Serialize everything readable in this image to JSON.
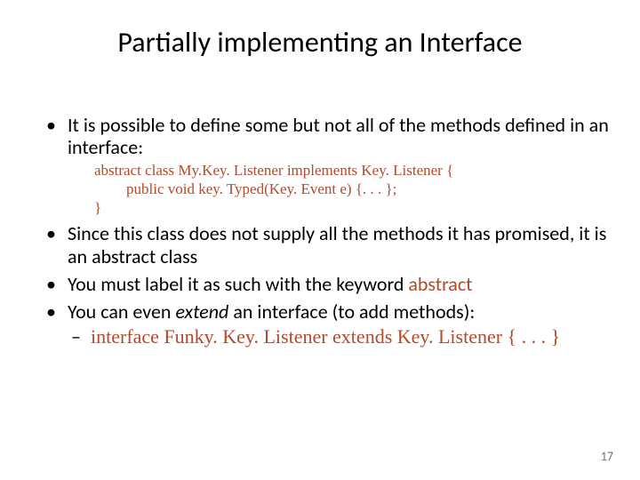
{
  "title": "Partially implementing an Interface",
  "bullets": {
    "b1": "It is possible to define some but not all of the methods defined in an interface:",
    "b2": "Since this class does not supply all the methods it has promised, it is an abstract class",
    "b3_pre": "You must label it as such with the keyword ",
    "b3_kw": "abstract",
    "b4_pre": "You can even ",
    "b4_em": "extend",
    "b4_post": " an interface (to add methods):"
  },
  "code": {
    "l1": "abstract class My.Key. Listener implements Key. Listener {",
    "l2": "public void key. Typed(Key. Event e) {. . . };",
    "l3": "}"
  },
  "sub": {
    "s1": "interface Funky. Key. Listener extends Key. Listener { . . . }"
  },
  "pagenum": "17"
}
